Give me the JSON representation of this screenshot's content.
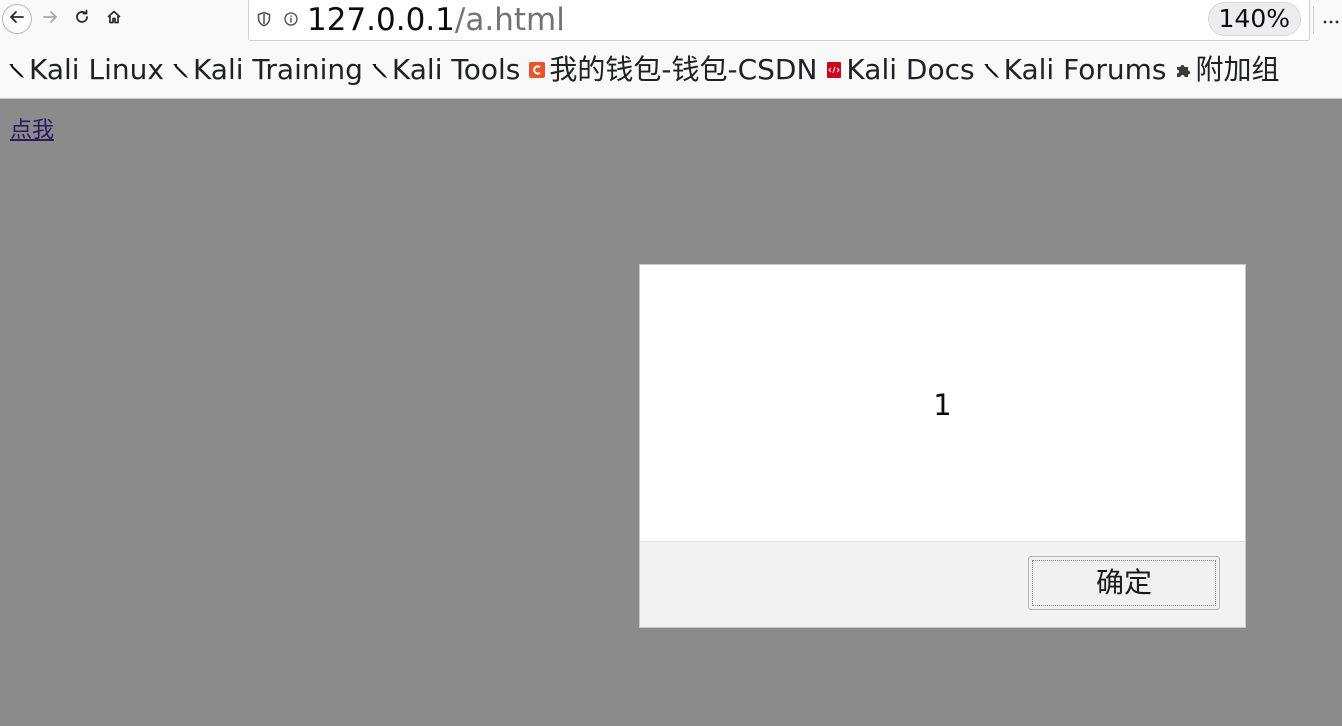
{
  "toolbar": {
    "url_host": "127.0.0.1",
    "url_path": "/a.html",
    "zoom": "140%",
    "icons": {
      "back": "arrow-left-icon",
      "forward": "arrow-right-icon",
      "reload": "reload-icon",
      "home": "home-icon",
      "tracking": "shield-icon",
      "site_info": "info-icon",
      "page_menu": "more-horizontal-icon"
    }
  },
  "bookmarks": [
    {
      "label": "Kali Linux",
      "icon": "kali-dragon-icon"
    },
    {
      "label": "Kali Training",
      "icon": "kali-dragon-icon"
    },
    {
      "label": "Kali Tools",
      "icon": "kali-dragon-icon"
    },
    {
      "label": "我的钱包-钱包-CSDN",
      "icon": "csdn-icon"
    },
    {
      "label": "Kali Docs",
      "icon": "docs-icon"
    },
    {
      "label": "Kali Forums",
      "icon": "kali-dragon-icon"
    },
    {
      "label": "附加组",
      "icon": "puzzle-icon"
    }
  ],
  "page": {
    "link_text": "点我"
  },
  "dialog": {
    "message": "1",
    "ok_label": "确定"
  },
  "colors": {
    "overlay": "#8b8b8b",
    "link": "#2b1b63",
    "csdn_brand": "#e8542c",
    "docs_brand": "#d0021b"
  }
}
